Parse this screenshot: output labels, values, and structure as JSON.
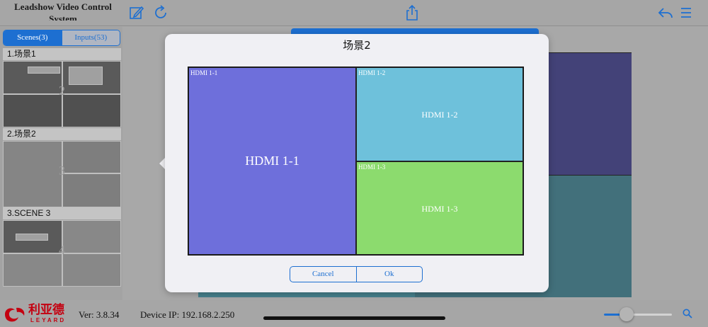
{
  "app": {
    "title": "Leadshow Video Control System"
  },
  "toolbar": {
    "icons": [
      "edit-icon",
      "refresh-icon",
      "share-icon",
      "reply-icon",
      "menu-icon"
    ]
  },
  "segments": {
    "scenes_label": "Scenes(3)",
    "inputs_label": "Inputs(53)",
    "active": "scenes"
  },
  "scenes": [
    {
      "label": "1.场景1",
      "number": "2"
    },
    {
      "label": "2.场景2",
      "number": "3"
    },
    {
      "label": "3.SCENE 3",
      "number": "4"
    }
  ],
  "dialog": {
    "title": "场景2",
    "windows": [
      {
        "caption": "HDMI 1-1",
        "label": "HDMI 1-1",
        "color": "#6e6fdb"
      },
      {
        "caption": "HDMI 1-2",
        "label": "HDMI 1-2",
        "color": "#6ec1db"
      },
      {
        "caption": "HDMI 1-3",
        "label": "HDMI 1-3",
        "color": "#8cdb6e"
      }
    ],
    "cancel_label": "Cancel",
    "ok_label": "Ok"
  },
  "footer": {
    "logo_cn": "利亚德",
    "logo_en": "LEYARD",
    "version": "Ver: 3.8.34",
    "device_ip": "Device IP: 192.168.2.250",
    "zoom_level": 0.33
  },
  "colors": {
    "accent": "#1d6fd1",
    "brand": "#c40010"
  }
}
